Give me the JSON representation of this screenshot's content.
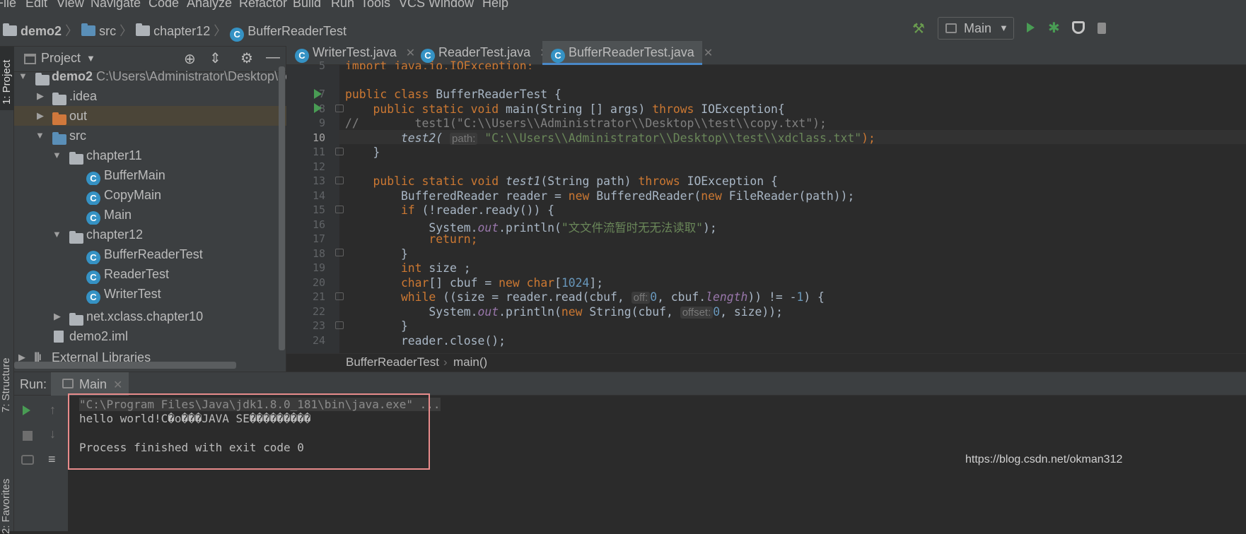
{
  "menu": [
    "File",
    "Edit",
    "View",
    "Navigate",
    "Code",
    "Analyze",
    "Refactor",
    "Build",
    "Run",
    "Tools",
    "VCS",
    "Window",
    "Help"
  ],
  "breadcrumb": {
    "project": "demo2",
    "src": "src",
    "package": "chapter12",
    "file": "BufferReaderTest"
  },
  "run_config": "Main",
  "side_tabs": {
    "project": "1: Project",
    "structure": "7: Structure",
    "favorites": "2: Favorites"
  },
  "project_panel": {
    "title": "Project"
  },
  "tree": [
    {
      "label": "demo2",
      "extra": "C:\\Users\\Administrator\\Desktop\\de"
    },
    {
      "label": ".idea"
    },
    {
      "label": "out"
    },
    {
      "label": "src"
    },
    {
      "label": "chapter11"
    },
    {
      "label": "BufferMain"
    },
    {
      "label": "CopyMain"
    },
    {
      "label": "Main"
    },
    {
      "label": "chapter12"
    },
    {
      "label": "BufferReaderTest"
    },
    {
      "label": "ReaderTest"
    },
    {
      "label": "WriterTest"
    },
    {
      "label": "net.xclass.chapter10"
    },
    {
      "label": "demo2.iml"
    },
    {
      "label": "External Libraries"
    }
  ],
  "tabs": [
    "WriterTest.java",
    "ReaderTest.java",
    "BufferReaderTest.java"
  ],
  "line_numbers": [
    "5",
    "7",
    "8",
    "9",
    "10",
    "11",
    "12",
    "13",
    "14",
    "15",
    "16",
    "17",
    "18",
    "19",
    "20",
    "21",
    "22",
    "23",
    "24"
  ],
  "code": {
    "l5": "import java.io.IOException;",
    "l7a": "public class",
    "l7b": " BufferReaderTest {",
    "l8a": "    public static void",
    "l8b": " main(String [] args) ",
    "l8c": "throws",
    "l8d": " IOException{",
    "l9": "//        test1(\"C:\\\\Users\\\\Administrator\\\\Desktop\\\\test\\\\copy.txt\");",
    "l10a": "        test2(",
    "l10hint": "path:",
    "l10b": "\"C:\\\\Users\\\\Administrator\\\\Desktop\\\\test\\\\xdclass.txt\"",
    "l10c": ");",
    "l11": "    }",
    "l13a": "    public static void",
    "l13b": " test1",
    "l13c": "(String path) ",
    "l13d": "throws",
    "l13e": " IOException {",
    "l14a": "        BufferedReader reader = ",
    "l14b": "new",
    "l14c": " BufferedReader(",
    "l14d": "new",
    "l14e": " FileReader(path));",
    "l15a": "        if",
    "l15b": " (!reader.ready()) {",
    "l16a": "            System.",
    "l16b": "out",
    "l16c": ".println(",
    "l16d": "\"文文件流暂时无无法读取\"",
    "l16e": ");",
    "l17": "            return;",
    "l18": "        }",
    "l19a": "        int",
    "l19b": " size ;",
    "l20a": "        char",
    "l20b": "[] cbuf = ",
    "l20c": "new char",
    "l20d": "[",
    "l20e": "1024",
    "l20f": "];",
    "l21a": "        while",
    "l21b": " ((size = reader.read(cbuf, ",
    "l21hint": "off:",
    "l21c": "0",
    "l21d": ", cbuf.",
    "l21e": "length",
    "l21f": ")) != -",
    "l21g": "1",
    "l21h": ") {",
    "l22a": "            System.",
    "l22b": "out",
    "l22c": ".println(",
    "l22d": "new",
    "l22e": " String(cbuf, ",
    "l22hint": "offset:",
    "l22f": "0",
    "l22g": ", size));",
    "l23": "        }",
    "l24": "        reader.close();"
  },
  "editor_crumb": {
    "cls": "BufferReaderTest",
    "method": "main()"
  },
  "run": {
    "label": "Run:",
    "tab": "Main"
  },
  "console": {
    "cmd": "\"C:\\Program Files\\Java\\jdk1.8.0_181\\bin\\java.exe\" ...",
    "out": "hello world!C�o���JAVA SE���������",
    "exit": "Process finished with exit code 0"
  },
  "watermark": "https://blog.csdn.net/okman312",
  "colors": {
    "keyword": "#cc7832",
    "string": "#6a8759",
    "number": "#6897bb",
    "accent": "#4a88c7",
    "highlight_box": "#e88b8b"
  }
}
